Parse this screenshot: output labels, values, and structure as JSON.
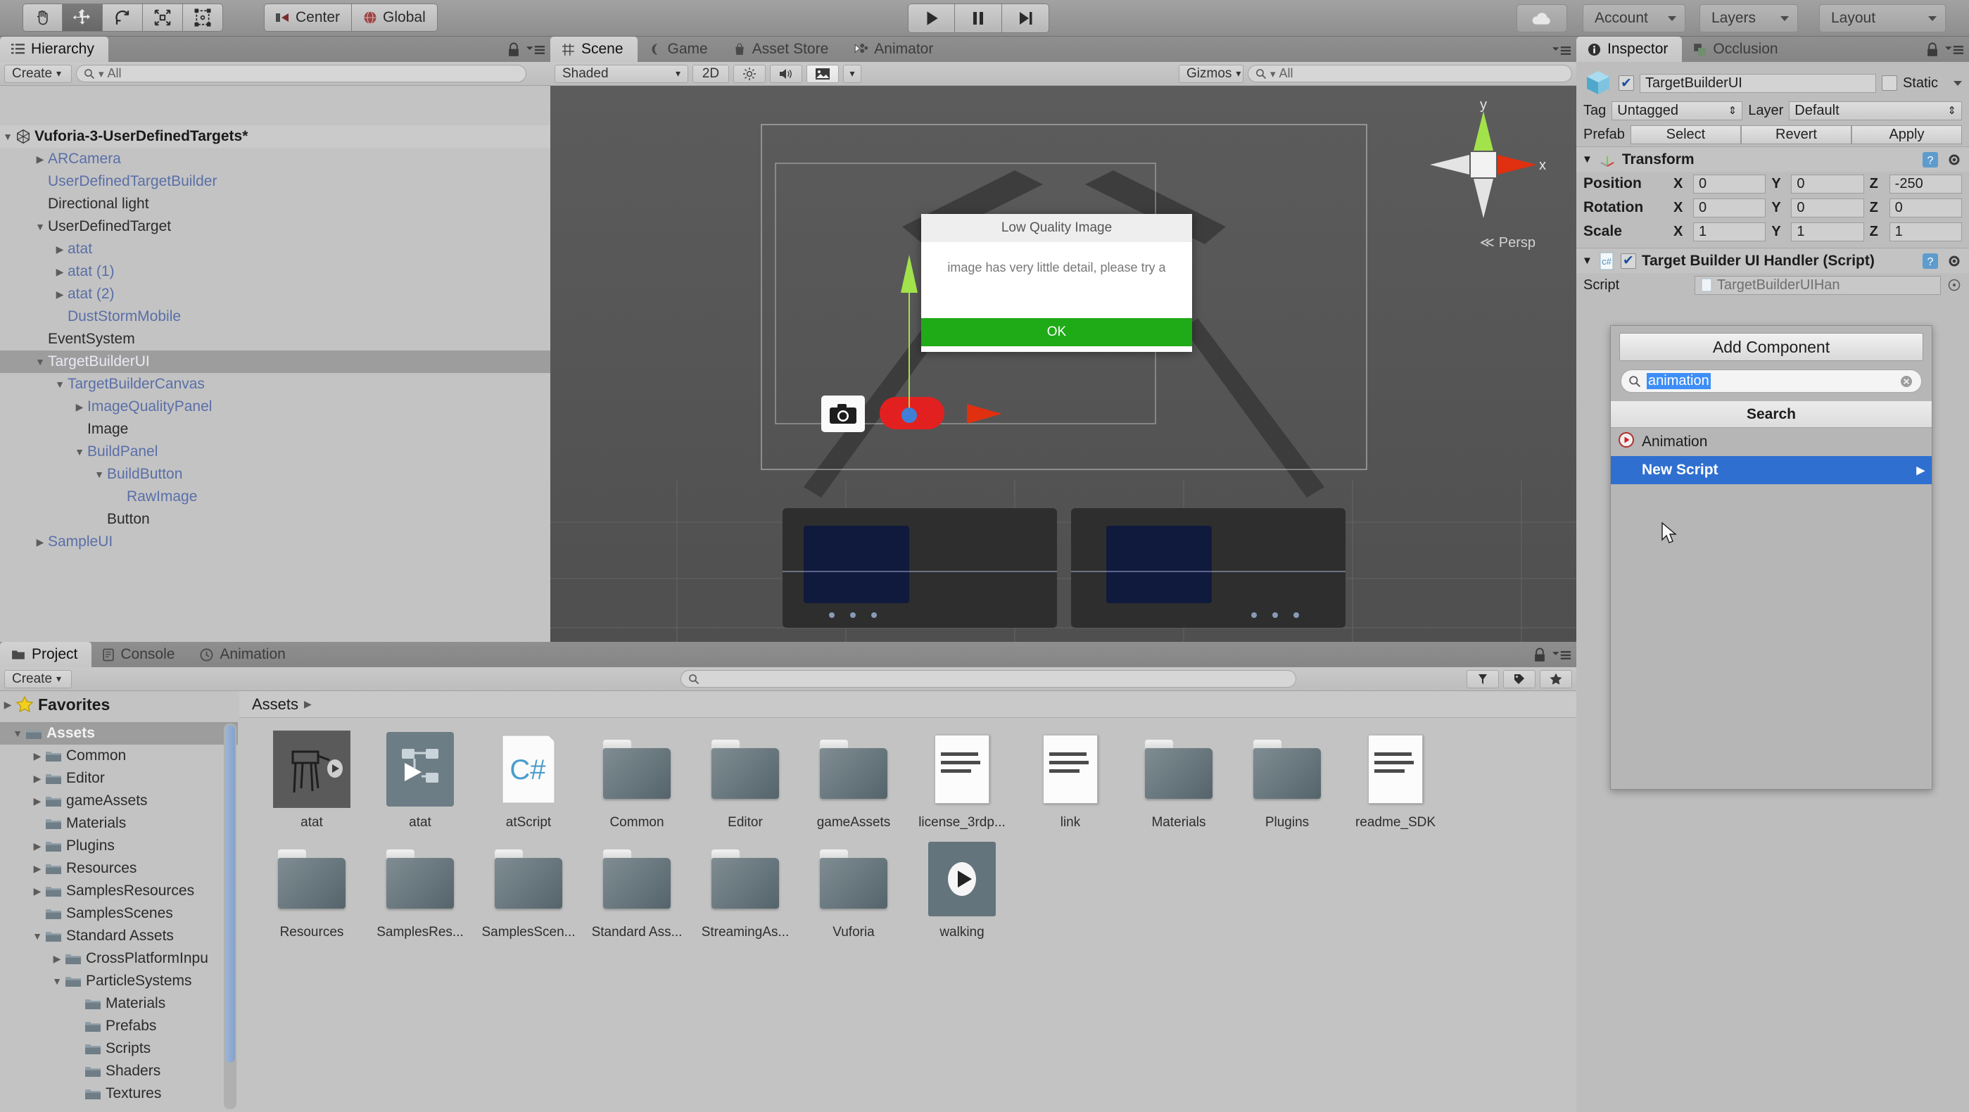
{
  "toolbar": {
    "tools": [
      {
        "name": "hand-tool",
        "icon": "hand"
      },
      {
        "name": "move-tool",
        "icon": "move",
        "active": true
      },
      {
        "name": "rotate-tool",
        "icon": "rotate"
      },
      {
        "name": "scale-tool",
        "icon": "scale"
      },
      {
        "name": "rect-tool",
        "icon": "rect"
      }
    ],
    "pivot_label": "Center",
    "space_label": "Global",
    "play_label": "play",
    "pause_label": "pause",
    "step_label": "step",
    "cloud_label": "cloud",
    "account_label": "Account",
    "layers_label": "Layers",
    "layout_label": "Layout"
  },
  "hierarchy": {
    "tabs": [
      {
        "label": "Hierarchy",
        "selected": true
      }
    ],
    "create_label": "Create",
    "search_placeholder": "All",
    "scene_name": "Vuforia-3-UserDefinedTargets*",
    "items": [
      {
        "label": "ARCamera",
        "indent": 1,
        "arrow": "right",
        "style": "prefab"
      },
      {
        "label": "UserDefinedTargetBuilder",
        "indent": 1,
        "arrow": "none",
        "style": "prefab"
      },
      {
        "label": "Directional light",
        "indent": 1,
        "arrow": "none",
        "style": "plain"
      },
      {
        "label": "UserDefinedTarget",
        "indent": 1,
        "arrow": "down",
        "style": "plain"
      },
      {
        "label": "atat",
        "indent": 2,
        "arrow": "right",
        "style": "prefab"
      },
      {
        "label": "atat (1)",
        "indent": 2,
        "arrow": "right",
        "style": "prefab"
      },
      {
        "label": "atat (2)",
        "indent": 2,
        "arrow": "right",
        "style": "prefab"
      },
      {
        "label": "DustStormMobile",
        "indent": 2,
        "arrow": "none",
        "style": "prefab"
      },
      {
        "label": "EventSystem",
        "indent": 1,
        "arrow": "none",
        "style": "plain"
      },
      {
        "label": "TargetBuilderUI",
        "indent": 1,
        "arrow": "down",
        "style": "prefab",
        "selected": true
      },
      {
        "label": "TargetBuilderCanvas",
        "indent": 2,
        "arrow": "down",
        "style": "prefab"
      },
      {
        "label": "ImageQualityPanel",
        "indent": 3,
        "arrow": "right",
        "style": "prefab"
      },
      {
        "label": "Image",
        "indent": 3,
        "arrow": "none",
        "style": "plain"
      },
      {
        "label": "BuildPanel",
        "indent": 3,
        "arrow": "down",
        "style": "prefab"
      },
      {
        "label": "BuildButton",
        "indent": 4,
        "arrow": "down",
        "style": "prefab"
      },
      {
        "label": "RawImage",
        "indent": 5,
        "arrow": "none",
        "style": "prefab"
      },
      {
        "label": "Button",
        "indent": 4,
        "arrow": "none",
        "style": "plain"
      },
      {
        "label": "SampleUI",
        "indent": 1,
        "arrow": "right",
        "style": "prefab"
      }
    ]
  },
  "scene": {
    "tabs": [
      {
        "label": "Scene",
        "selected": true,
        "icon": "grid-icon"
      },
      {
        "label": "Game",
        "selected": false,
        "icon": "moon-icon"
      },
      {
        "label": "Asset Store",
        "selected": false,
        "icon": "bag-icon"
      },
      {
        "label": "Animator",
        "selected": false,
        "icon": "nodes-icon"
      }
    ],
    "draw_mode": "Shaded",
    "mode_2d": "2D",
    "gizmos_label": "Gizmos",
    "search_placeholder": "All",
    "gizmo_axis_x": "x",
    "gizmo_axis_y": "y",
    "projection_label": "Persp",
    "dialog": {
      "title": "Low Quality Image",
      "body": "image has very little detail, please try a",
      "ok_label": "OK"
    }
  },
  "project": {
    "tabs": [
      {
        "label": "Project",
        "selected": true,
        "icon": "folder-icon"
      },
      {
        "label": "Console",
        "selected": false,
        "icon": "console-icon"
      },
      {
        "label": "Animation",
        "selected": false,
        "icon": "clock-icon"
      }
    ],
    "create_label": "Create",
    "search_placeholder": "",
    "breadcrumb": "Assets",
    "favorites_label": "Favorites",
    "tree": [
      {
        "label": "Assets",
        "indent": 0,
        "arrow": "down",
        "selected": true
      },
      {
        "label": "Common",
        "indent": 1,
        "arrow": "right"
      },
      {
        "label": "Editor",
        "indent": 1,
        "arrow": "right"
      },
      {
        "label": "gameAssets",
        "indent": 1,
        "arrow": "right"
      },
      {
        "label": "Materials",
        "indent": 1,
        "arrow": "none"
      },
      {
        "label": "Plugins",
        "indent": 1,
        "arrow": "right"
      },
      {
        "label": "Resources",
        "indent": 1,
        "arrow": "right"
      },
      {
        "label": "SamplesResources",
        "indent": 1,
        "arrow": "right"
      },
      {
        "label": "SamplesScenes",
        "indent": 1,
        "arrow": "none"
      },
      {
        "label": "Standard Assets",
        "indent": 1,
        "arrow": "down"
      },
      {
        "label": "CrossPlatformInpu",
        "indent": 2,
        "arrow": "right"
      },
      {
        "label": "ParticleSystems",
        "indent": 2,
        "arrow": "down"
      },
      {
        "label": "Materials",
        "indent": 3,
        "arrow": "none"
      },
      {
        "label": "Prefabs",
        "indent": 3,
        "arrow": "none"
      },
      {
        "label": "Scripts",
        "indent": 3,
        "arrow": "none"
      },
      {
        "label": "Shaders",
        "indent": 3,
        "arrow": "none"
      },
      {
        "label": "Textures",
        "indent": 3,
        "arrow": "none"
      }
    ],
    "assets": [
      {
        "label": "atat",
        "type": "model",
        "selected": true
      },
      {
        "label": "atat",
        "type": "prefab"
      },
      {
        "label": "atScript",
        "type": "csharp"
      },
      {
        "label": "Common",
        "type": "folder"
      },
      {
        "label": "Editor",
        "type": "folder"
      },
      {
        "label": "gameAssets",
        "type": "folder"
      },
      {
        "label": "license_3rdp...",
        "type": "text"
      },
      {
        "label": "link",
        "type": "text"
      },
      {
        "label": "Materials",
        "type": "folder"
      },
      {
        "label": "Plugins",
        "type": "folder"
      },
      {
        "label": "readme_SDK",
        "type": "text"
      },
      {
        "label": "Resources",
        "type": "folder"
      },
      {
        "label": "SamplesRes...",
        "type": "folder"
      },
      {
        "label": "SamplesScen...",
        "type": "folder"
      },
      {
        "label": "Standard Ass...",
        "type": "folder"
      },
      {
        "label": "StreamingAs...",
        "type": "folder"
      },
      {
        "label": "Vuforia",
        "type": "folder"
      },
      {
        "label": "walking",
        "type": "anim"
      }
    ]
  },
  "inspector": {
    "tabs": [
      {
        "label": "Inspector",
        "selected": true,
        "icon": "info-icon"
      },
      {
        "label": "Occlusion",
        "selected": false,
        "icon": "occlusion-icon"
      }
    ],
    "object_name": "TargetBuilderUI",
    "object_enabled": true,
    "static_label": "Static",
    "tag_label": "Tag",
    "tag_value": "Untagged",
    "layer_label": "Layer",
    "layer_value": "Default",
    "prefab_label": "Prefab",
    "prefab_select": "Select",
    "prefab_revert": "Revert",
    "prefab_apply": "Apply",
    "transform": {
      "title": "Transform",
      "rows": [
        {
          "label": "Position",
          "x": "0",
          "y": "0",
          "z": "-250"
        },
        {
          "label": "Rotation",
          "x": "0",
          "y": "0",
          "z": "0"
        },
        {
          "label": "Scale",
          "x": "1",
          "y": "1",
          "z": "1"
        }
      ],
      "axis_x": "X",
      "axis_y": "Y",
      "axis_z": "Z"
    },
    "script_component": {
      "title": "Target Builder UI Handler (Script)",
      "enabled": true,
      "script_label": "Script",
      "script_value": "TargetBuilderUIHan"
    },
    "add_component": {
      "button_label": "Add Component",
      "search_value": "animation",
      "search_header": "Search",
      "results": [
        {
          "label": "Animation",
          "selected": false,
          "icon": "animation-icon"
        },
        {
          "label": "New Script",
          "selected": true,
          "icon": "none",
          "submenu": true
        }
      ]
    }
  },
  "colors": {
    "selection_blue": "#2f6fd0",
    "prefab_text": "#5a6fa8",
    "ok_green": "#1faa18",
    "gizmo_x": "#e03010",
    "gizmo_y": "#a2e24b"
  }
}
